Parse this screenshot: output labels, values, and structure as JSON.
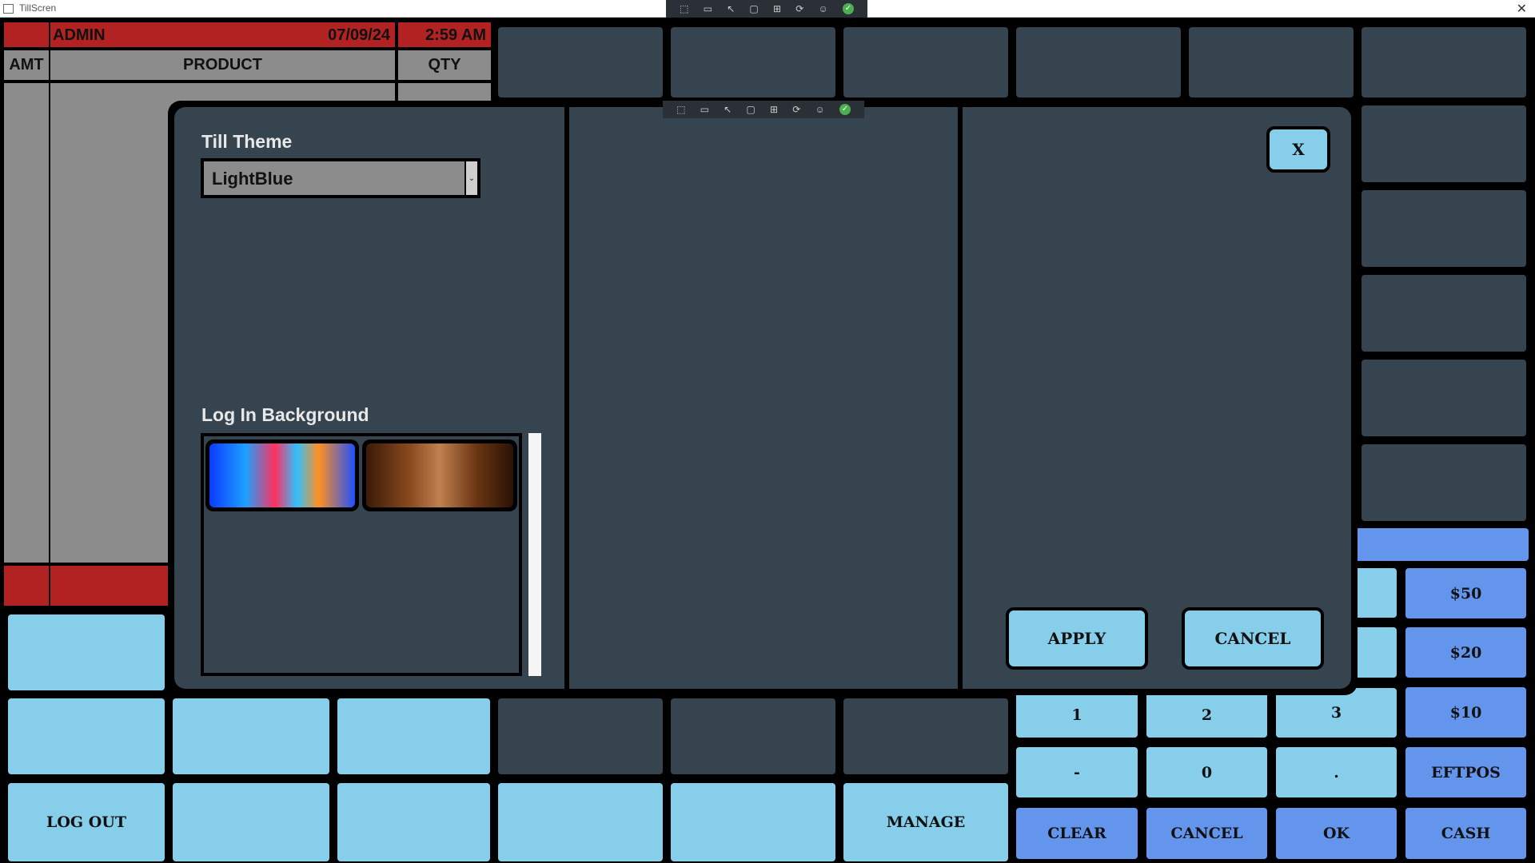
{
  "window": {
    "title": "TillScren"
  },
  "header": {
    "user": "ADMIN",
    "date": "07/09/24",
    "time": "2:59 AM"
  },
  "order_table": {
    "col_amt": "AMT",
    "col_product": "PRODUCT",
    "col_qty": "QTY"
  },
  "modal": {
    "theme_label": "Till Theme",
    "theme_value": "LightBlue",
    "background_label": "Log In Background",
    "close_label": "X",
    "apply_label": "APPLY",
    "cancel_label": "CANCEL"
  },
  "bottom": {
    "logout_label": "LOG OUT",
    "manage_label": "MANAGE"
  },
  "keypad": {
    "k1": "1",
    "k2": "2",
    "k3": "3",
    "kminus": "-",
    "k0": "0",
    "kdot": ".",
    "clear": "CLEAR",
    "cancel": "CANCEL",
    "ok": "OK"
  },
  "tender": {
    "t50": "$50",
    "t20": "$20",
    "t10": "$10",
    "eftpos": "EFTPOS",
    "cash": "CASH"
  },
  "colors": {
    "accent_red": "#b22222",
    "light_blue": "#87ceeb",
    "cornflower": "#6495ed",
    "panel": "#36444f"
  }
}
